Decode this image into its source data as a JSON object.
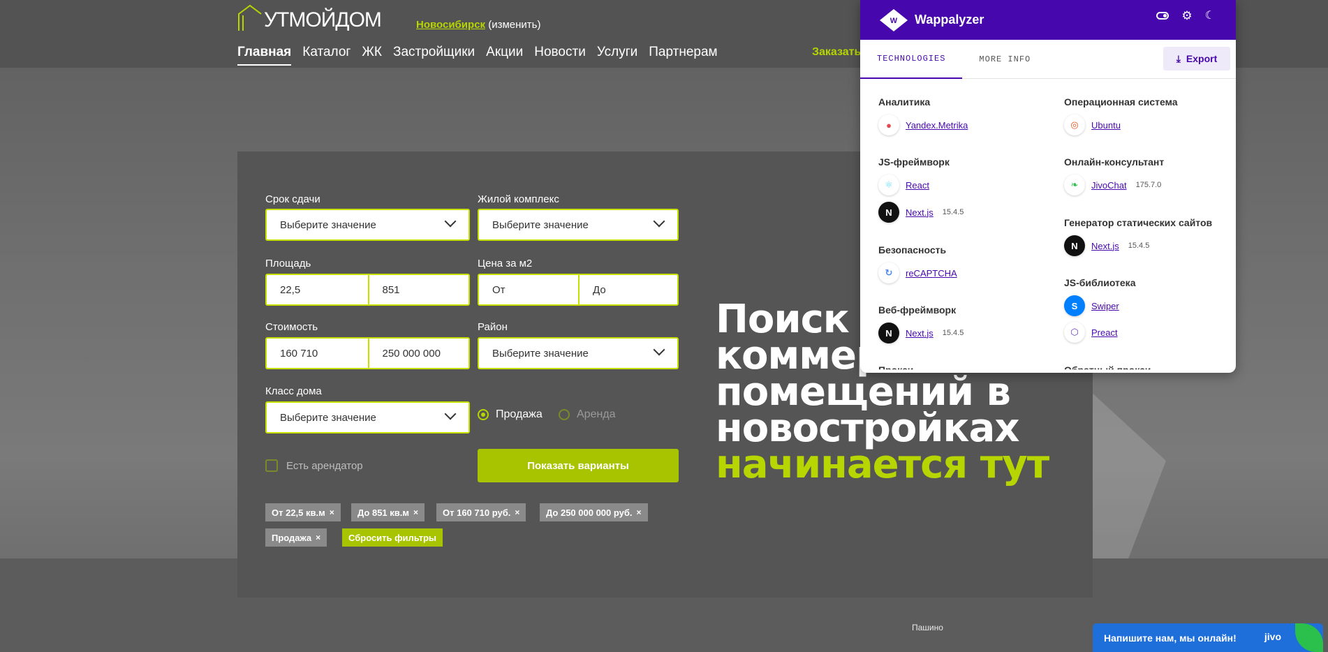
{
  "header": {
    "logo_text": "УТМОЙДОМ",
    "city": "Новосибирск",
    "city_change": "(изменить)",
    "nav": [
      "Главная",
      "Каталог",
      "ЖК",
      "Застройщики",
      "Акции",
      "Новости",
      "Услуги",
      "Партнерам"
    ],
    "order_label": "Заказать"
  },
  "filters": {
    "deadline_label": "Срок сдачи",
    "deadline_value": "Выберите значение",
    "complex_label": "Жилой комплекс",
    "complex_value": "Выберите значение",
    "area_label": "Площадь",
    "area_from": "22,5",
    "area_to": "851",
    "price_m2_label": "Цена за м2",
    "price_m2_from": "От",
    "price_m2_to": "До",
    "cost_label": "Стоимость",
    "cost_from": "160 710",
    "cost_to": "250 000 000",
    "district_label": "Район",
    "district_value": "Выберите значение",
    "class_label": "Класс дома",
    "class_value": "Выберите значение",
    "radio_sale": "Продажа",
    "radio_rent": "Аренда",
    "tenant_label": "Есть арендатор",
    "show_button": "Показать варианты",
    "chips": [
      "От 22,5 кв.м",
      "До 851 кв.м",
      "От 160 710 руб.",
      "До 250 000 000 руб.",
      "Продажа"
    ],
    "chip_close": "×",
    "reset_label": "Сбросить фильтры"
  },
  "headline": {
    "line1": "Поиск",
    "line2": "коммер",
    "line3": "помещений в",
    "line4": "новостройках",
    "line5": "начинается тут"
  },
  "map": {
    "label": "Пашино"
  },
  "wappalyzer": {
    "title": "Wappalyzer",
    "tabs": [
      "TECHNOLOGIES",
      "MORE INFO"
    ],
    "export_label": "Export",
    "left": [
      {
        "category": "Аналитика",
        "items": [
          {
            "name": "Yandex.Metrika",
            "version": ""
          }
        ]
      },
      {
        "category": "JS-фреймворк",
        "items": [
          {
            "name": "React",
            "version": ""
          },
          {
            "name": "Next.js",
            "version": "15.4.5"
          }
        ]
      },
      {
        "category": "Безопасность",
        "items": [
          {
            "name": "reCAPTCHA",
            "version": ""
          }
        ]
      },
      {
        "category": "Веб-фреймворк",
        "items": [
          {
            "name": "Next.js",
            "version": "15.4.5"
          }
        ]
      }
    ],
    "right": [
      {
        "category": "Операционная система",
        "items": [
          {
            "name": "Ubuntu",
            "version": ""
          }
        ]
      },
      {
        "category": "Онлайн-консультант",
        "items": [
          {
            "name": "JivoChat",
            "version": "175.7.0"
          }
        ]
      },
      {
        "category": "Генератор статических сайтов",
        "items": [
          {
            "name": "Next.js",
            "version": "15.4.5"
          }
        ]
      },
      {
        "category": "JS-библиотека",
        "items": [
          {
            "name": "Swiper",
            "version": ""
          },
          {
            "name": "Preact",
            "version": ""
          }
        ]
      }
    ],
    "cut_left": "Прокси",
    "cut_right": "Обратный прокси"
  },
  "jivo": {
    "text": "Напишите нам, мы онлайн!",
    "brand": "jivo"
  },
  "colors": {
    "accent": "#b7d500",
    "wappalyzer": "#4608ad",
    "jivo": "#1e6fd9"
  }
}
